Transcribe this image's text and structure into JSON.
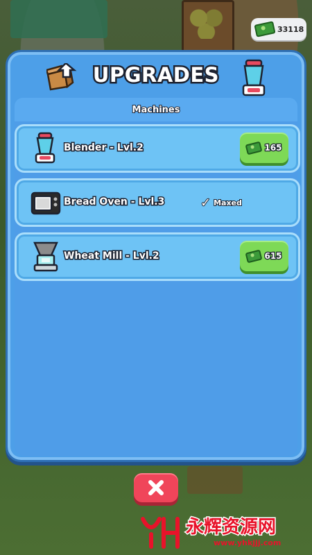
{
  "currency": {
    "icon": "cash-icon",
    "value": "33118"
  },
  "panel": {
    "title": "UPGRADES",
    "section_label": "Machines",
    "header_icons": [
      "box-upgrade-icon",
      "blender-icon"
    ]
  },
  "items": [
    {
      "label": "Blender - Lvl.2",
      "icon": "blender-icon",
      "action": "buy",
      "price": "165"
    },
    {
      "label": "Bread Oven - Lvl.3",
      "icon": "oven-icon",
      "action": "maxed",
      "status": "Maxed"
    },
    {
      "label": "Wheat Mill - Lvl.2",
      "icon": "wheat-mill-icon",
      "action": "buy",
      "price": "615"
    }
  ],
  "close_button": {
    "icon": "close-icon"
  },
  "watermark": {
    "title": "永辉资源网",
    "url": "www.yhkjjj.com"
  },
  "colors": {
    "panel": "#4d9fe8",
    "item": "#6ec3f5",
    "buy_button": "#7ed957",
    "close_button": "#f0455a"
  }
}
